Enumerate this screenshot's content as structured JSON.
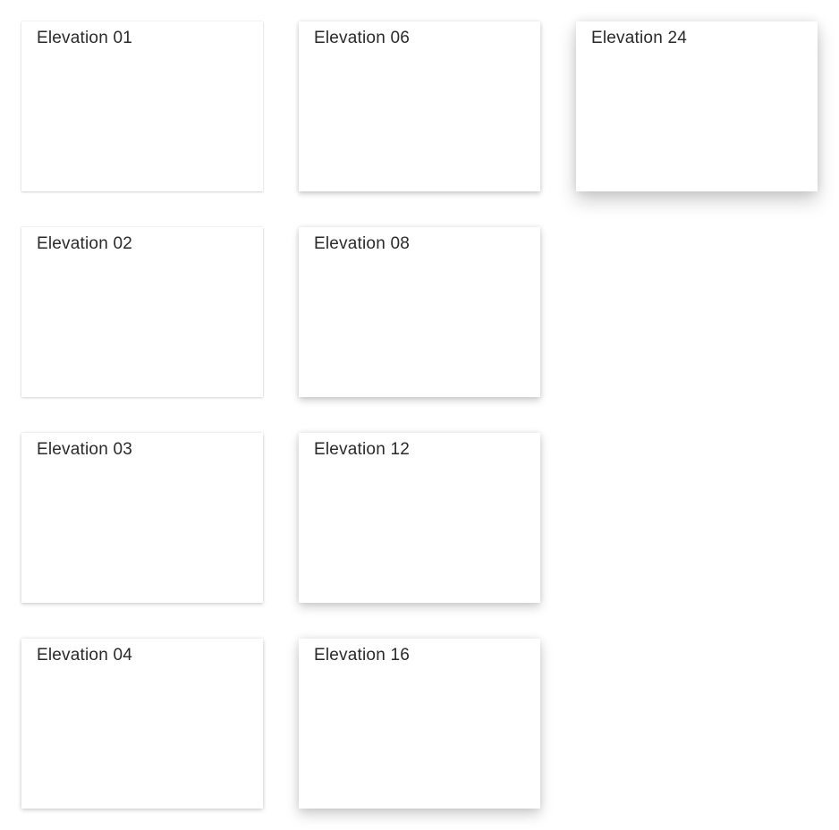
{
  "cards": [
    {
      "label": "Elevation 01"
    },
    {
      "label": "Elevation 02"
    },
    {
      "label": "Elevation 03"
    },
    {
      "label": "Elevation 04"
    },
    {
      "label": "Elevation 06"
    },
    {
      "label": "Elevation 08"
    },
    {
      "label": "Elevation 12"
    },
    {
      "label": "Elevation 16"
    },
    {
      "label": "Elevation 24"
    }
  ]
}
